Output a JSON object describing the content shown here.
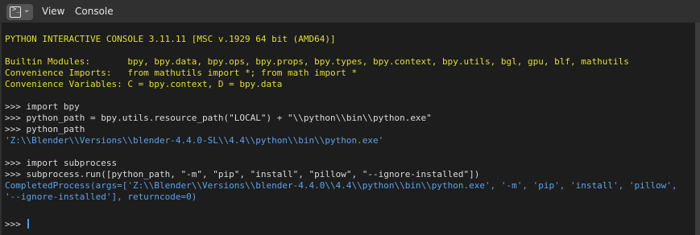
{
  "header": {
    "menu": [
      "View",
      "Console"
    ]
  },
  "console": {
    "banner": "PYTHON INTERACTIVE CONSOLE 3.11.11 [MSC v.1929 64 bit (AMD64)]",
    "info_lines": [
      "Builtin Modules:       bpy, bpy.data, bpy.ops, bpy.props, bpy.types, bpy.context, bpy.utils, bgl, gpu, blf, mathutils",
      "Convenience Imports:   from mathutils import *; from math import *",
      "Convenience Variables: C = bpy.context, D = bpy.data"
    ],
    "block1_inputs": [
      ">>> import bpy",
      ">>> python_path = bpy.utils.resource_path(\"LOCAL\") + \"\\\\python\\\\bin\\\\python.exe\"",
      ">>> python_path"
    ],
    "block1_output": "'Z:\\\\Blender\\\\Versions\\\\blender-4.4.0-SL\\\\4.4\\\\python\\\\bin\\\\python.exe'",
    "block2_inputs": [
      ">>> import subprocess",
      ">>> subprocess.run([python_path, \"-m\", \"pip\", \"install\", \"pillow\", \"--ignore-installed\"])"
    ],
    "block2_outputs": [
      "CompletedProcess(args=['Z:\\\\Blender\\\\Versions\\\\blender-4.4.0\\\\4.4\\\\python\\\\bin\\\\python.exe', '-m', 'pip', 'install', 'pillow',",
      "'--ignore-installed'], returncode=0)"
    ],
    "prompt": ">>> ",
    "colors": {
      "input": "#d9d9d9",
      "output": "#5fa1e6",
      "info": "#dede3a",
      "cursor": "#4a9bf2"
    }
  }
}
